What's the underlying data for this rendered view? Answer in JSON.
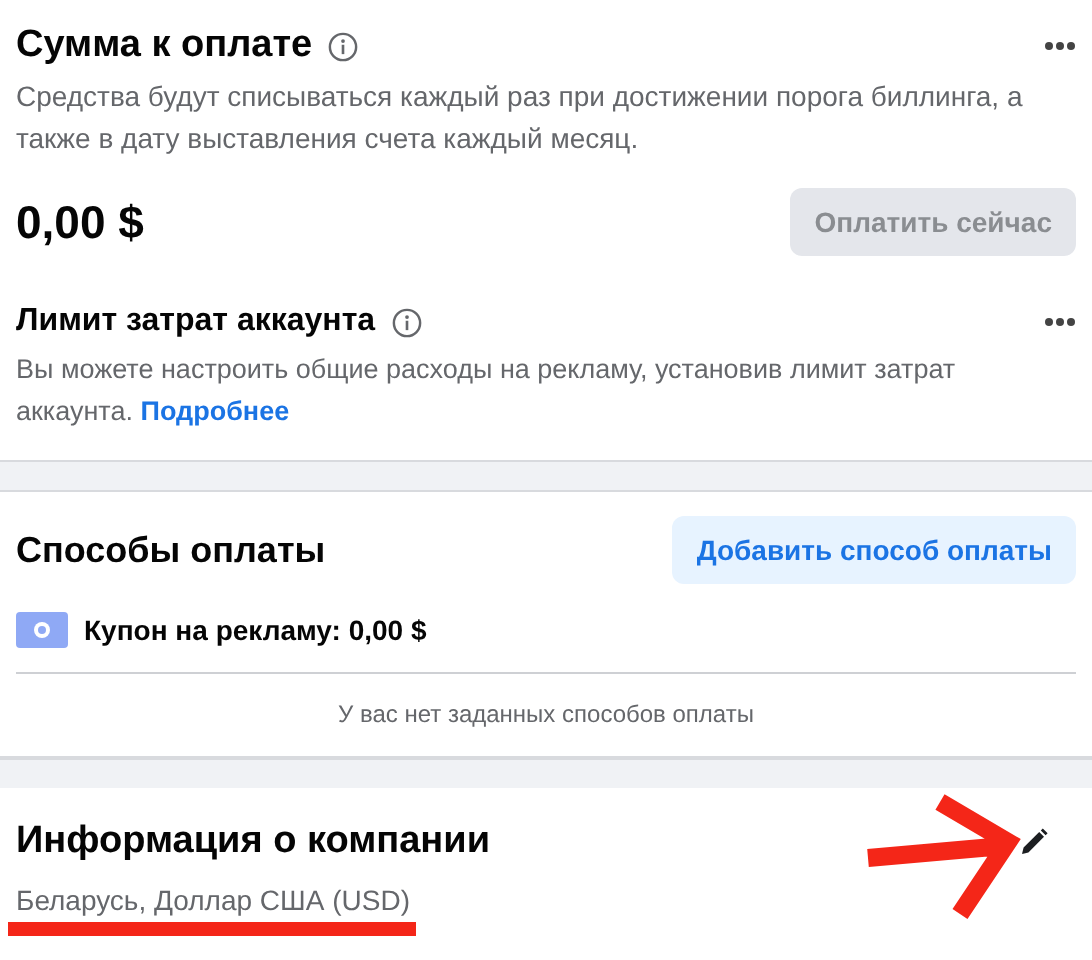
{
  "amount_due": {
    "title": "Сумма к оплате",
    "description": "Средства будут списываться каждый раз при достижении порога биллинга, а также в дату выставления счета каждый месяц.",
    "amount": "0,00 $",
    "pay_button": {
      "label": "Оплатить сейчас",
      "disabled": true
    }
  },
  "spending_limit": {
    "title": "Лимит затрат аккаунта",
    "description": "Вы можете настроить общие расходы на рекламу, установив лимит затрат аккаунта.",
    "link": "Подробнее"
  },
  "payment_methods": {
    "title": "Способы оплаты",
    "add_button": "Добавить способ оплаты",
    "coupon": "Купон на рекламу: 0,00 $",
    "empty_note": "У вас нет заданных способов оплаты"
  },
  "company_info": {
    "title": "Информация о компании",
    "details": "Беларусь, Доллар США (USD)"
  }
}
